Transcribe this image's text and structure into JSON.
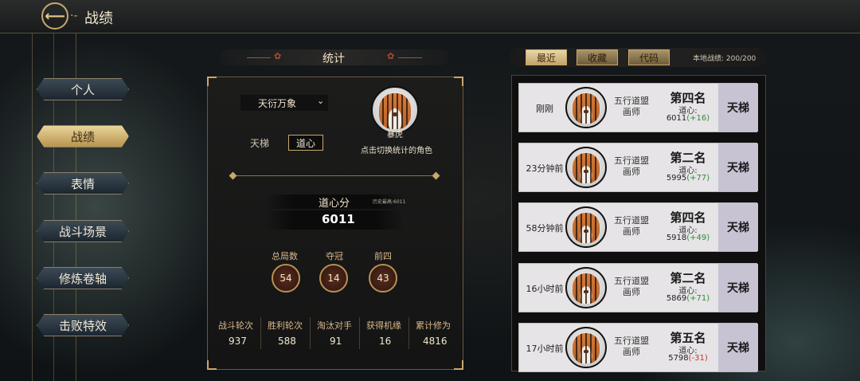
{
  "header": {
    "title": "战绩",
    "back_icon": "back-arrow-icon"
  },
  "sidebar": {
    "items": [
      {
        "label": "个人",
        "active": false
      },
      {
        "label": "战绩",
        "active": true
      },
      {
        "label": "表情",
        "active": false
      },
      {
        "label": "战斗场景",
        "active": false
      },
      {
        "label": "修炼卷轴",
        "active": false
      },
      {
        "label": "击败特效",
        "active": false
      }
    ]
  },
  "stats": {
    "title": "统计",
    "mode_select": "天衍万象",
    "toggle_options": [
      "天梯",
      "道心"
    ],
    "toggle_selected": "道心",
    "player_name": "暴虎",
    "switch_hint": "点击切换统计的角色",
    "score_label": "道心分",
    "history_best": "历史最高:6011",
    "score_value": "6011",
    "metrics": [
      {
        "label": "总局数",
        "value": "54"
      },
      {
        "label": "夺冠",
        "value": "14"
      },
      {
        "label": "前四",
        "value": "43"
      }
    ],
    "totals": [
      {
        "label": "战斗轮次",
        "value": "937"
      },
      {
        "label": "胜利轮次",
        "value": "588"
      },
      {
        "label": "淘汰对手",
        "value": "91"
      },
      {
        "label": "获得机缘",
        "value": "16"
      },
      {
        "label": "累计修为",
        "value": "4816"
      }
    ]
  },
  "records": {
    "tabs": [
      "最近",
      "收藏",
      "代码"
    ],
    "active_tab": "最近",
    "local_count": "本地战绩: 200/200",
    "items": [
      {
        "time": "刚刚",
        "org": "五行道盟",
        "role": "画师",
        "rank": "第四名",
        "dx_label": "道心:",
        "dx_score": "6011",
        "delta": "(+16)",
        "delta_sign": "pos",
        "mode": "天梯"
      },
      {
        "time": "23分钟前",
        "org": "五行道盟",
        "role": "画师",
        "rank": "第二名",
        "dx_label": "道心:",
        "dx_score": "5995",
        "delta": "(+77)",
        "delta_sign": "pos",
        "mode": "天梯"
      },
      {
        "time": "58分钟前",
        "org": "五行道盟",
        "role": "画师",
        "rank": "第四名",
        "dx_label": "道心:",
        "dx_score": "5918",
        "delta": "(+49)",
        "delta_sign": "pos",
        "mode": "天梯"
      },
      {
        "time": "16小时前",
        "org": "五行道盟",
        "role": "画师",
        "rank": "第二名",
        "dx_label": "道心:",
        "dx_score": "5869",
        "delta": "(+71)",
        "delta_sign": "pos",
        "mode": "天梯"
      },
      {
        "time": "17小时前",
        "org": "五行道盟",
        "role": "画师",
        "rank": "第五名",
        "dx_label": "道心:",
        "dx_score": "5798",
        "delta": "(-31)",
        "delta_sign": "neg",
        "mode": "天梯"
      }
    ]
  },
  "colors": {
    "gold": "#c9a86a",
    "positive": "#2e8b3a",
    "negative": "#c0392b"
  }
}
